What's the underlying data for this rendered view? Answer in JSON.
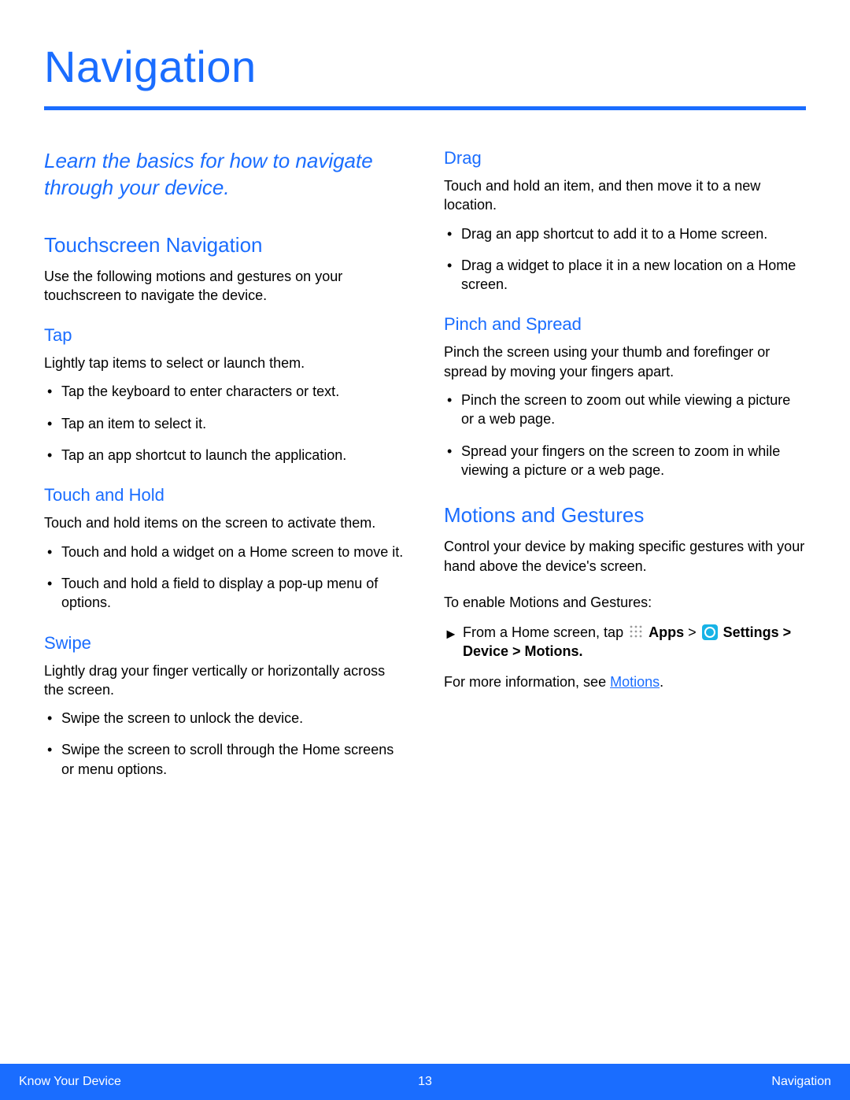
{
  "title": "Navigation",
  "intro": "Learn the basics for how to navigate through your device.",
  "left": {
    "touchscreen": {
      "heading": "Touchscreen Navigation",
      "body": "Use the following motions and gestures on your touchscreen to navigate the device."
    },
    "tap": {
      "heading": "Tap",
      "body": "Lightly tap items to select or launch them.",
      "items": [
        "Tap the keyboard to enter characters or text.",
        "Tap an item to select it.",
        "Tap an app shortcut to launch the application."
      ]
    },
    "hold": {
      "heading": "Touch and Hold",
      "body": "Touch and hold items on the screen to activate them.",
      "items": [
        "Touch and hold a widget on a Home screen to move it.",
        "Touch and hold a field to display a pop-up menu of options."
      ]
    },
    "swipe": {
      "heading": "Swipe",
      "body": "Lightly drag your finger vertically or horizontally across the screen.",
      "items": [
        "Swipe the screen to unlock the device.",
        "Swipe the screen to scroll through the Home screens or menu options."
      ]
    }
  },
  "right": {
    "drag": {
      "heading": "Drag",
      "body": "Touch and hold an item, and then move it to a new location.",
      "items": [
        "Drag an app shortcut to add it to a Home screen.",
        "Drag a widget to place it in a new location on a Home screen."
      ]
    },
    "pinch": {
      "heading": "Pinch and Spread",
      "body": "Pinch the screen using your thumb and forefinger or spread by moving your fingers apart.",
      "items": [
        "Pinch the screen to zoom out while viewing a picture or a web page.",
        "Spread your fingers on the screen to zoom in while viewing a picture or a web page."
      ]
    },
    "motions": {
      "heading": "Motions and Gestures",
      "body": "Control your device by making specific gestures with your hand above the device's screen.",
      "enable_label": "To enable Motions and Gestures:",
      "step_prefix": "From a Home screen, tap ",
      "apps_label": "Apps",
      "sep1": " > ",
      "settings_label": "Settings",
      "path_suffix": " > Device > Motions",
      "more_prefix": "For more information, see ",
      "more_link": "Motions",
      "more_suffix": "."
    }
  },
  "footer": {
    "left": "Know Your Device",
    "center": "13",
    "right": "Navigation"
  }
}
